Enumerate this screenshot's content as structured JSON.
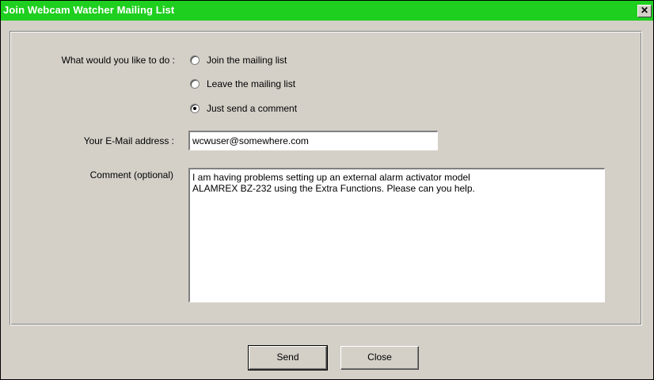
{
  "window": {
    "title": "Join Webcam Watcher Mailing List",
    "close_label": "✕",
    "titlebar_color": "#1fcf1f"
  },
  "form": {
    "action_label": "What would you like to do :",
    "options": [
      {
        "label": "Join the mailing list",
        "selected": false
      },
      {
        "label": "Leave the mailing list",
        "selected": false
      },
      {
        "label": "Just send a comment",
        "selected": true
      }
    ],
    "email_label": "Your E-Mail address :",
    "email_value": "wcwuser@somewhere.com",
    "comment_label": "Comment (optional)",
    "comment_value": "I am having problems setting up an external alarm activator model\nALAMREX BZ-232 using the Extra Functions. Please can you help."
  },
  "buttons": {
    "send": "Send",
    "close": "Close"
  }
}
